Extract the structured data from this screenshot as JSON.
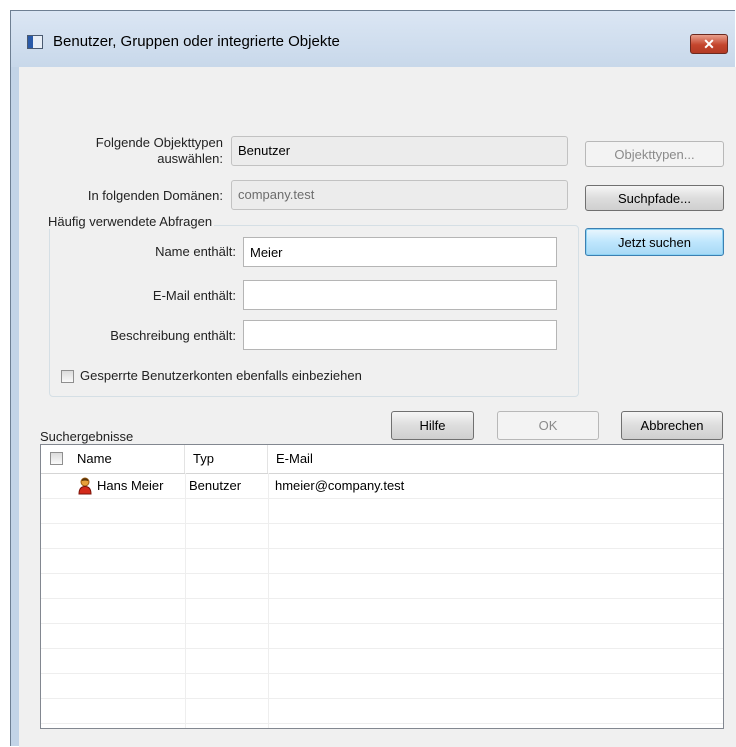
{
  "window": {
    "title": "Benutzer, Gruppen oder integrierte Objekte",
    "close_label": "✕"
  },
  "object_types": {
    "label": "Folgende Objekttypen auswählen:",
    "value": "Benutzer",
    "button": "Objekttypen..."
  },
  "domains": {
    "label": "In folgenden Domänen:",
    "value": "company.test",
    "button": "Suchpfade..."
  },
  "queries": {
    "legend": "Häufig verwendete Abfragen",
    "name_label": "Name enthält:",
    "name_value": "Meier",
    "email_label": "E-Mail enthält:",
    "email_value": "",
    "description_label": "Beschreibung enthält:",
    "description_value": "",
    "disabled_accounts_label": "Gesperrte Benutzerkonten ebenfalls einbeziehen",
    "disabled_accounts_checked": false
  },
  "buttons": {
    "search_now": "Jetzt suchen",
    "help": "Hilfe",
    "ok": "OK",
    "cancel": "Abbrechen"
  },
  "results": {
    "title": "Suchergebnisse",
    "columns": [
      "Name",
      "Typ",
      "E-Mail"
    ],
    "rows": [
      {
        "name": "Hans Meier",
        "type": "Benutzer",
        "email": "hmeier@company.test",
        "icon": "user-icon"
      }
    ]
  }
}
